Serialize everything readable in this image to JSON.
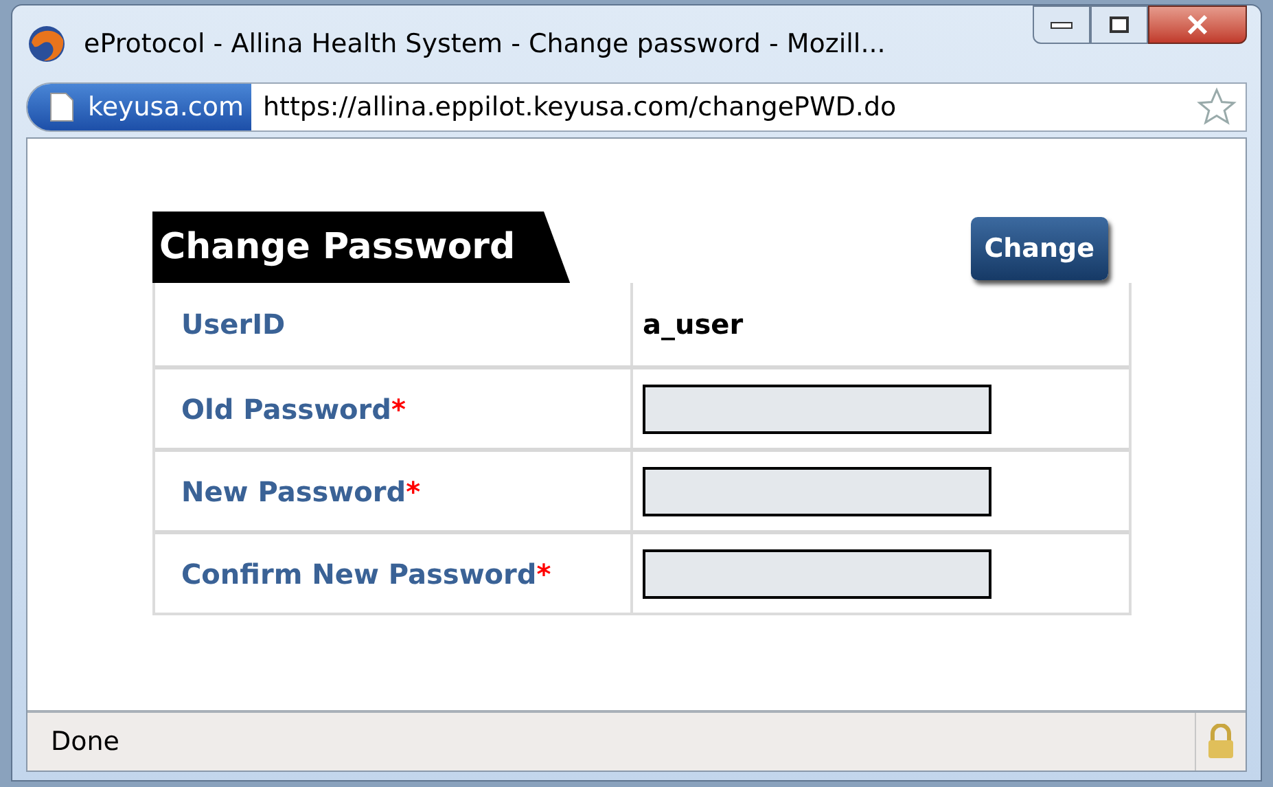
{
  "window": {
    "title": "eProtocol - Allina Health System - Change password - Mozill..."
  },
  "address_bar": {
    "site_badge": "keyusa.com",
    "url": "https://allina.eppilot.keyusa.com/changePWD.do"
  },
  "form": {
    "title": "Change Password",
    "button": "Change",
    "rows": [
      {
        "label": "UserID",
        "kind": "value",
        "value": "a_user"
      },
      {
        "label": "Old Password",
        "kind": "input",
        "required_mark": "*"
      },
      {
        "label": "New Password",
        "kind": "input",
        "required_mark": "*"
      },
      {
        "label": "Confirm New Password",
        "kind": "input",
        "required_mark": "*"
      }
    ]
  },
  "status_bar": {
    "text": "Done"
  }
}
